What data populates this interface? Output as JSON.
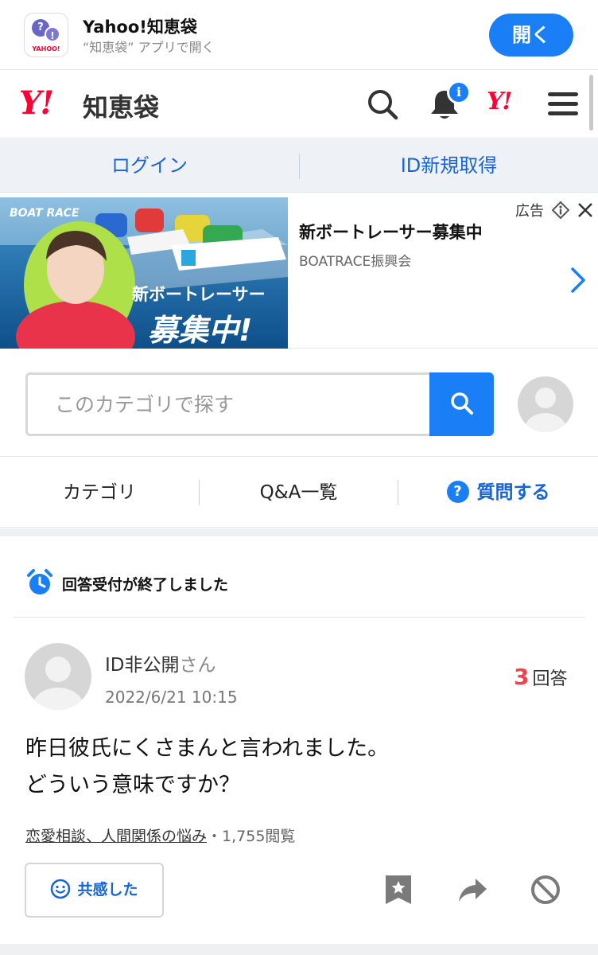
{
  "app_banner": {
    "icon_text": "YAHOO!",
    "name": "Yahoo!知恵袋",
    "subtitle": "“知恵袋” アプリで開く",
    "open_label": "開く"
  },
  "header": {
    "logo_mark": "Y!",
    "logo_text": "知恵袋",
    "notification_badge": "i",
    "yahoo_mark": "Y!"
  },
  "login_bar": {
    "login_label": "ログイン",
    "register_label": "ID新規取得"
  },
  "ad": {
    "label": "広告",
    "title": "新ボートレーサー募集中",
    "sponsor": "BOATRACE振興会",
    "image_brand": "BOAT RACE",
    "image_headline_1": "新ボートレーサー",
    "image_headline_2": "募集中!"
  },
  "search": {
    "placeholder": "このカテゴリで探す"
  },
  "nav": {
    "category": "カテゴリ",
    "qa_list": "Q&A一覧",
    "ask": "質問する"
  },
  "notice": {
    "closed": "回答受付が終了しました"
  },
  "question": {
    "author": "ID非公開",
    "author_suffix": "さん",
    "date": "2022/6/21 10:15",
    "answer_count": "3",
    "answer_label": "回答",
    "body_line1": "昨日彼氏にくさまんと言われました。",
    "body_line2": "どういう意味ですか？",
    "category": "恋愛相談、人間関係の悩み",
    "views": "・1,755閲覧",
    "empathy_label": "共感した"
  },
  "colors": {
    "accent_blue": "#1a7ff7",
    "link_blue": "#1763d8",
    "yahoo_red": "#ff0033",
    "answer_red": "#e5484d"
  },
  "icons": [
    "search-icon",
    "bell-icon",
    "menu-icon",
    "chevron-right-icon",
    "info-icon",
    "close-icon",
    "alarm-clock-icon",
    "smile-icon",
    "bookmark-star-icon",
    "share-icon",
    "block-icon"
  ]
}
